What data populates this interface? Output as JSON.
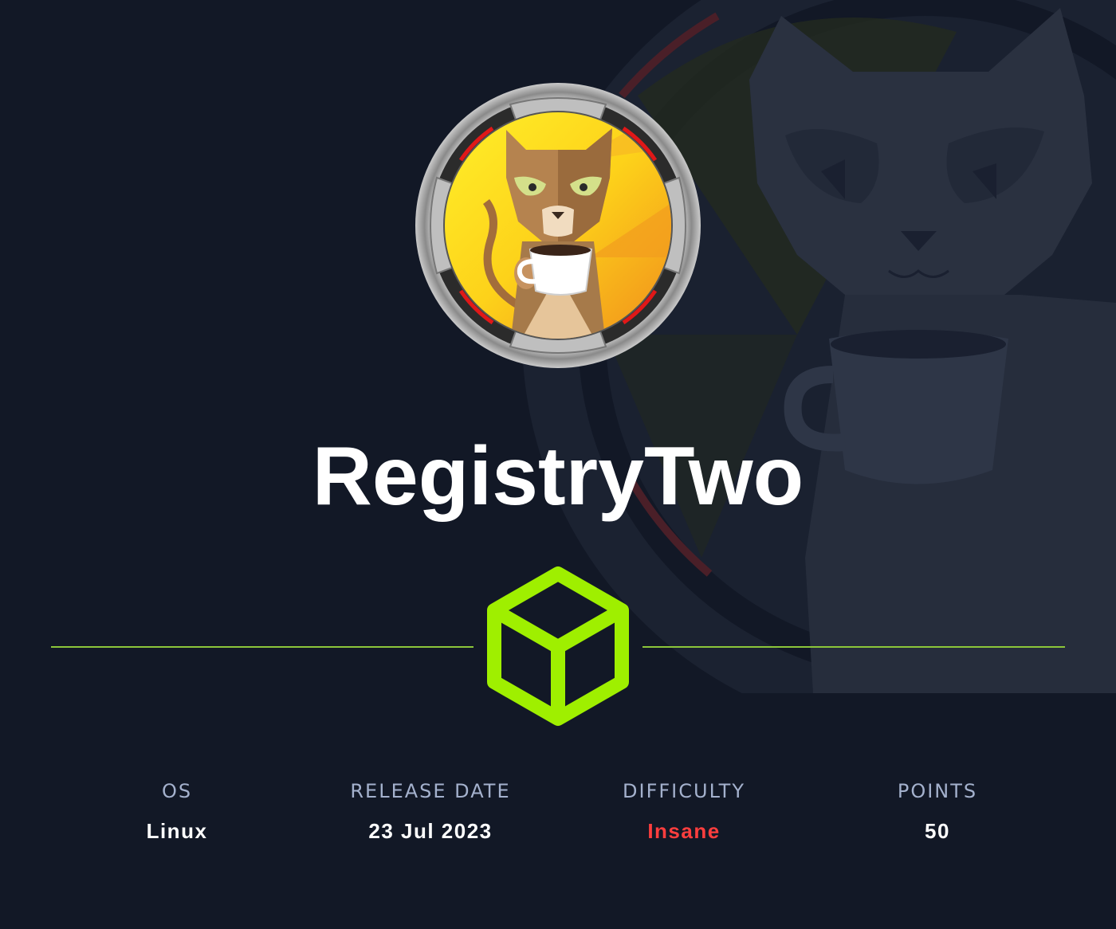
{
  "machine": {
    "name": "RegistryTwo"
  },
  "stats": [
    {
      "label": "OS",
      "value": "Linux"
    },
    {
      "label": "RELEASE DATE",
      "value": "23 Jul 2023"
    },
    {
      "label": "DIFFICULTY",
      "value": "Insane"
    },
    {
      "label": "POINTS",
      "value": "50"
    }
  ],
  "colors": {
    "background": "#121826",
    "accent_green": "#9fef00",
    "divider": "#8cc63a",
    "difficulty_insane": "#ff3e3e",
    "label_gray": "#a4b1cd",
    "title_white": "#ffffff"
  },
  "icons": {
    "avatar": "cat-with-coffee-cup-avatar",
    "background_art": "cat-with-coffee-cup-watermark",
    "platform_logo": "green-cube-icon"
  }
}
